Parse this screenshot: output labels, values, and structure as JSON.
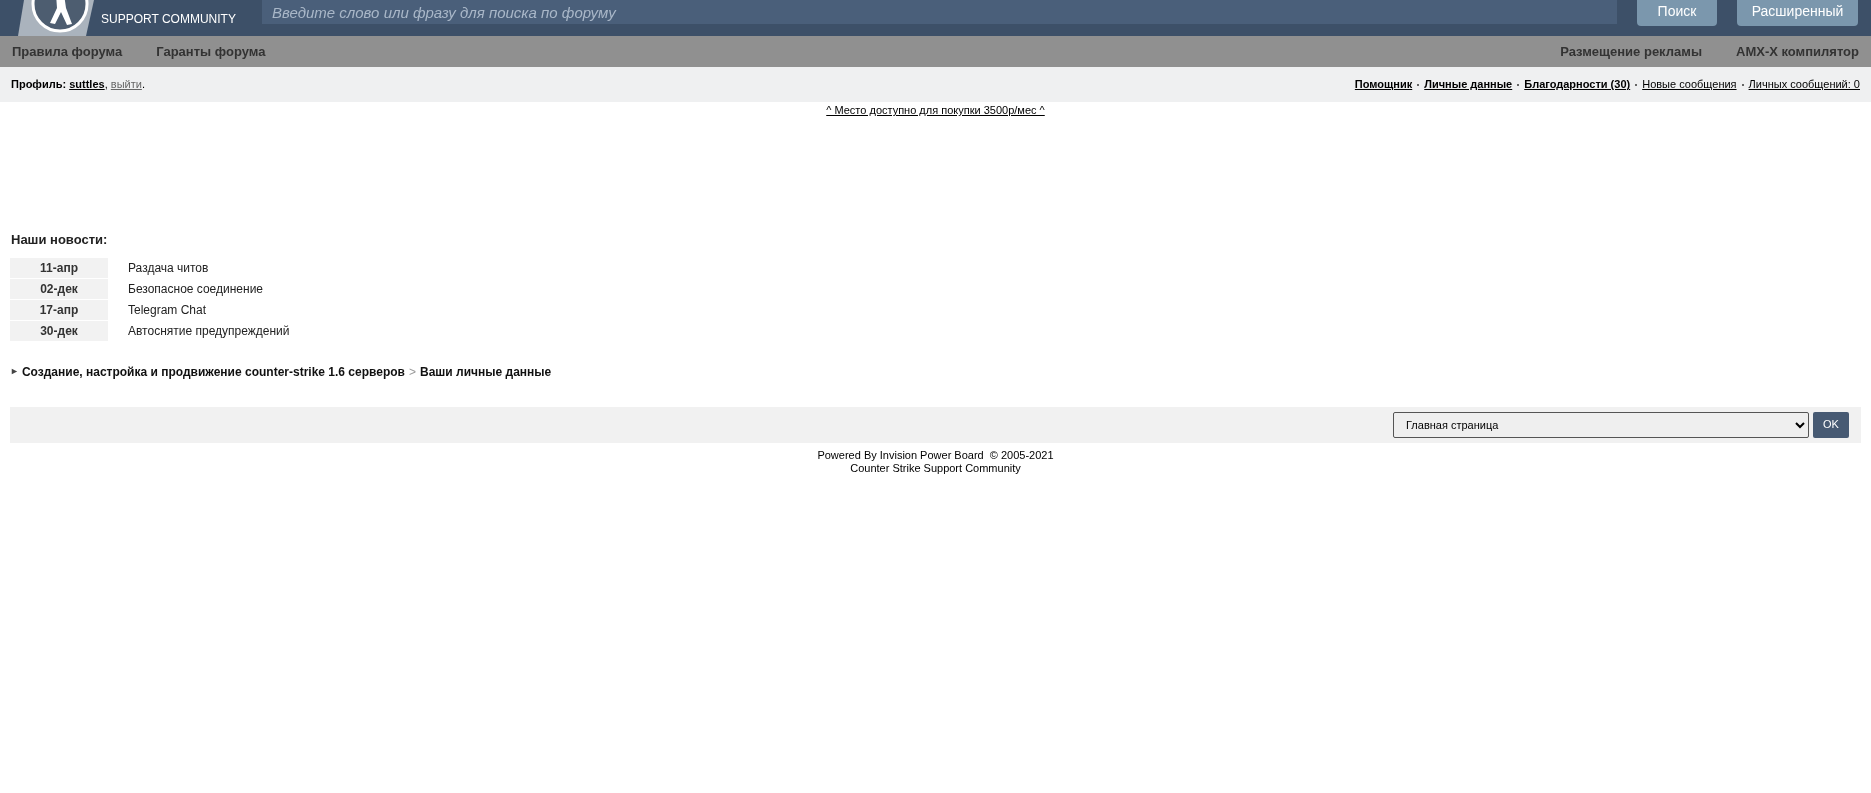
{
  "header": {
    "logo_text": "SUPPORT COMMUNITY",
    "search": {
      "placeholder": "Введите слово или фразу для поиска по форуму"
    },
    "buttons": [
      "Поиск",
      "Расширенный"
    ]
  },
  "nav": {
    "left": [
      "Правила форума",
      "Гаранты форума"
    ],
    "right": [
      "Размещение рекламы",
      "AMX-X компилятор"
    ]
  },
  "profile": {
    "label": "Профиль:",
    "user": "suttles",
    "user_separator": ",",
    "logout": "выйти",
    "end_mark": ".",
    "links": [
      {
        "text": "Помощник",
        "bold": true
      },
      {
        "text": "Личные данные",
        "bold": true
      },
      {
        "text": "Благодарности (30)",
        "bold": true
      },
      {
        "text": "Новые сообщения",
        "bold": false
      },
      {
        "text": "Личных сообщений: 0",
        "bold": false
      }
    ]
  },
  "ad_link": "^ Место доступно для покупки 3500р/мес ^",
  "news": {
    "title": "Наши новости:",
    "items": [
      {
        "date": "11-апр",
        "title": "Раздача читов"
      },
      {
        "date": "02-дек",
        "title": "Безопасное соединение"
      },
      {
        "date": "17-апр",
        "title": "Telegram Chat"
      },
      {
        "date": "30-дек",
        "title": "Автоснятие предупреждений"
      }
    ]
  },
  "breadcrumb": {
    "marker": "►",
    "items": [
      "Создание, настройка и продвижение counter-strike 1.6 серверов",
      "Ваши личные данные"
    ],
    "separator": ">"
  },
  "jump": {
    "value": "Главная страница",
    "button": "OK"
  },
  "footer": [
    "Powered By Invision Power Board  © 2005-2021",
    "Counter Strike Support Community"
  ]
}
